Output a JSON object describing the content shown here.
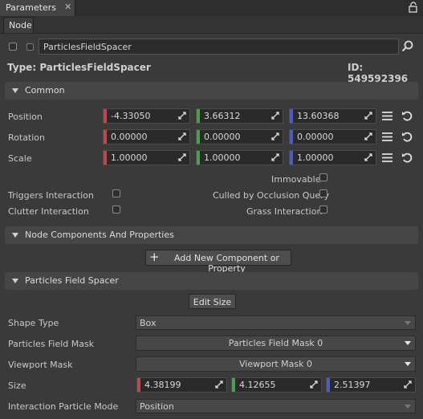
{
  "window": {
    "tab_title": "Parameters",
    "tab_close": "✕",
    "subtab": "Node"
  },
  "node": {
    "name": "ParticlesFieldSpacer",
    "type_label": "Type:",
    "type_value": "ParticlesFieldSpacer",
    "id_label": "ID:",
    "id_value": "549592396"
  },
  "sections": {
    "common": "Common",
    "components": "Node Components And Properties",
    "spacer": "Particles Field Spacer"
  },
  "transform": {
    "position": {
      "label": "Position",
      "x": "-4.33050",
      "y": "3.66312",
      "z": "13.60368"
    },
    "rotation": {
      "label": "Rotation",
      "x": "0.00000",
      "y": "0.00000",
      "z": "0.00000"
    },
    "scale": {
      "label": "Scale",
      "x": "1.00000",
      "y": "1.00000",
      "z": "1.00000"
    }
  },
  "flags": {
    "immovable": "Immovable",
    "triggers_interaction": "Triggers Interaction",
    "culled_by_occlusion": "Culled by Occlusion Query",
    "clutter_interaction": "Clutter Interaction",
    "grass_interaction": "Grass Interaction"
  },
  "components": {
    "add_button": "Add New Component or Property",
    "add_icon": "+"
  },
  "spacer": {
    "edit_size_button": "Edit Size",
    "shape_type": {
      "label": "Shape Type",
      "value": "Box"
    },
    "particles_field_mask": {
      "label": "Particles Field Mask",
      "value": "Particles Field Mask 0"
    },
    "viewport_mask": {
      "label": "Viewport Mask",
      "value": "Viewport Mask 0"
    },
    "size": {
      "label": "Size",
      "x": "4.38199",
      "y": "4.12655",
      "z": "2.51397"
    },
    "interaction_mode": {
      "label": "Interaction Particle Mode",
      "value": "Position"
    }
  },
  "colors": {
    "x_axis": "#c04848",
    "y_axis": "#4aa04a",
    "z_axis": "#4a5cc8",
    "background": "#3a3a3a",
    "section": "#454545"
  },
  "icons": {
    "lock": "lock-icon",
    "search": "search-icon",
    "menu": "menu-icon",
    "reset": "reset-icon",
    "drag": "drag-handle-icon"
  }
}
